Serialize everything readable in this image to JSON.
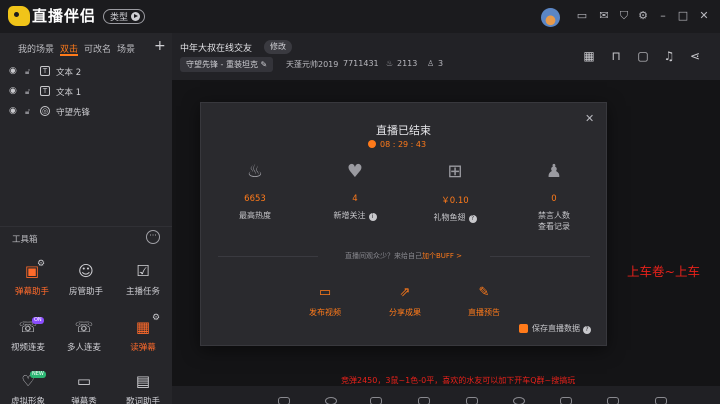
{
  "app": {
    "title": "直播伴侣",
    "type_button": "类型"
  },
  "scene_tabs": [
    {
      "label": "我的场景",
      "active": false
    },
    {
      "label": "双击",
      "active": true
    },
    {
      "label": "可改名",
      "active": false
    },
    {
      "label": "场景",
      "active": false
    }
  ],
  "sources": [
    {
      "label": "文本 2",
      "kind_icon": "text-source-icon"
    },
    {
      "label": "文本 1",
      "kind_icon": "text-source-icon"
    },
    {
      "label": "守望先锋",
      "kind_icon": "game-capture-icon"
    }
  ],
  "toolbox": {
    "title": "工具箱",
    "tools": [
      {
        "label": "弹幕助手",
        "icon": "danmaku-icon",
        "highlighted": true
      },
      {
        "label": "房管助手",
        "icon": "admin-icon",
        "highlighted": false
      },
      {
        "label": "主播任务",
        "icon": "task-icon",
        "highlighted": false
      },
      {
        "label": "视频连麦",
        "icon": "video-link-icon",
        "highlighted": false,
        "badge": "ON"
      },
      {
        "label": "多人连麦",
        "icon": "multi-link-icon",
        "highlighted": false
      },
      {
        "label": "读弹幕",
        "icon": "read-danmaku-icon",
        "highlighted": true
      },
      {
        "label": "虚拟形象",
        "icon": "avatar-icon",
        "highlighted": false,
        "badge": "NEW"
      },
      {
        "label": "弹幕秀",
        "icon": "danmaku-show-icon",
        "highlighted": false
      },
      {
        "label": "歌词助手",
        "icon": "lyrics-icon",
        "highlighted": false
      }
    ]
  },
  "header": {
    "room_title": "中年大叔在线交友",
    "edit_label": "修改",
    "category": "守望先锋 - 重装坦克",
    "streamer": "天蓬元帅2019",
    "room_id": "7711431",
    "heat": "2113",
    "viewers": "3"
  },
  "preview": {
    "overlay_text": "上车卷~上车",
    "ticker_text": "竞弹2450，3鼠~1色-0平，喜欢的水友可以加下开车Q群~搜搞玩"
  },
  "end_modal": {
    "title": "直播已结束",
    "duration": "08 : 29 : 43",
    "stats": [
      {
        "value": "6653",
        "label": "最高热度",
        "icon": "fire-icon"
      },
      {
        "value": "4",
        "label": "新增关注",
        "icon": "heart-plus-icon",
        "info": true
      },
      {
        "value": "￥0.10",
        "label": "礼物鱼翅",
        "icon": "gift-icon",
        "info": true
      },
      {
        "value": "0",
        "label": "禁言人数",
        "label2": "查看记录",
        "icon": "mute-user-icon"
      }
    ],
    "hint_prefix": "直播间观众少？来给自己",
    "hint_link": "加个BUFF >",
    "actions": [
      {
        "label": "发布视频",
        "icon": "video-icon"
      },
      {
        "label": "分享成果",
        "icon": "share-icon"
      },
      {
        "label": "直播预告",
        "icon": "edit-notice-icon"
      }
    ],
    "save_label": "保存直播数据",
    "save_checked": true
  },
  "colors": {
    "accent": "#ff7a1a",
    "overlay_red": "#e8211a",
    "background": "#222226"
  }
}
